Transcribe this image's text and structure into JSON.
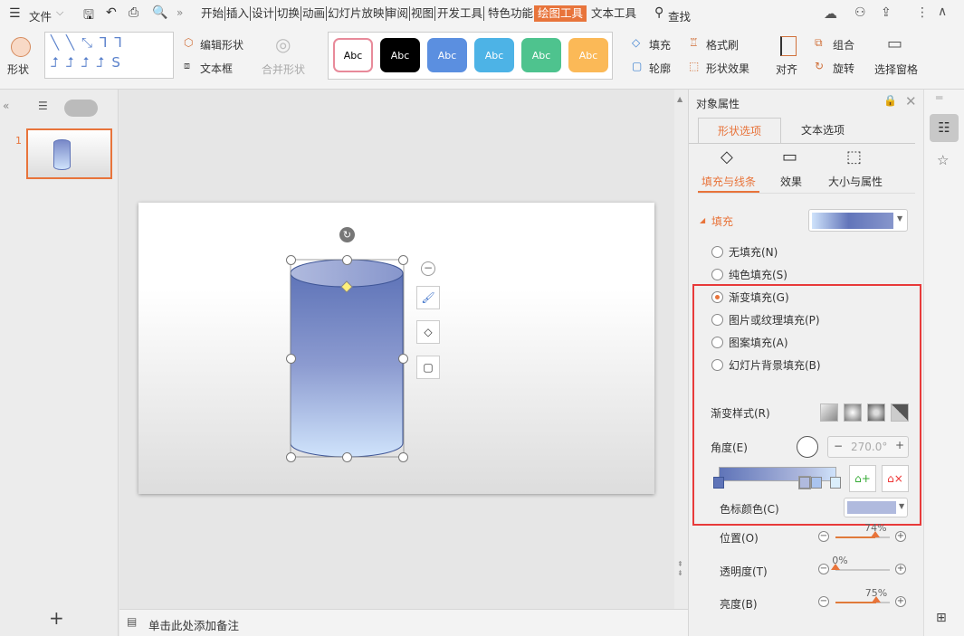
{
  "menu": {
    "file": "文件",
    "tabs": [
      "开始",
      "插入",
      "设计",
      "切换",
      "动画",
      "幻灯片放映",
      "审阅",
      "视图",
      "开发工具",
      "特色功能",
      "绘图工具",
      "文本工具"
    ],
    "active_tab": "绘图工具",
    "search": "查找"
  },
  "ribbon": {
    "shapes": "形状",
    "edit_shape": "编辑形状",
    "text_box": "文本框",
    "merge_shape": "合并形状",
    "styles": [
      "Abc",
      "Abc",
      "Abc",
      "Abc",
      "Abc",
      "Abc"
    ],
    "fill": "填充",
    "format_painter": "格式刷",
    "outline": "轮廓",
    "shape_effects": "形状效果",
    "align": "对齐",
    "group": "组合",
    "rotate": "旋转",
    "selection_pane": "选择窗格"
  },
  "slides": {
    "number": "1"
  },
  "notes": {
    "placeholder": "单击此处添加备注"
  },
  "pane": {
    "title": "对象属性",
    "tabs": [
      "形状选项",
      "文本选项"
    ],
    "subtabs": [
      "填充与线条",
      "效果",
      "大小与属性"
    ],
    "fill_section": "填充",
    "fill_options": [
      "无填充(N)",
      "纯色填充(S)",
      "渐变填充(G)",
      "图片或纹理填充(P)",
      "图案填充(A)",
      "幻灯片背景填充(B)"
    ],
    "selected_fill": "渐变填充(G)",
    "gradient_style": "渐变样式(R)",
    "angle_label": "角度(E)",
    "angle_value": "270.0°",
    "stop_color_label": "色标颜色(C)",
    "stop_color": "#b0bade",
    "position_label": "位置(O)",
    "position_value": "74%",
    "position": 74,
    "transparency_label": "透明度(T)",
    "transparency_value": "0%",
    "transparency": 0,
    "brightness_label": "亮度(B)",
    "brightness_value": "75%",
    "brightness": 75
  },
  "colors": {
    "accent": "#e8743b",
    "gradient_dark": "#5f74b8",
    "gradient_light": "#cfe3fb",
    "highlight_box": "#e83a3a"
  }
}
